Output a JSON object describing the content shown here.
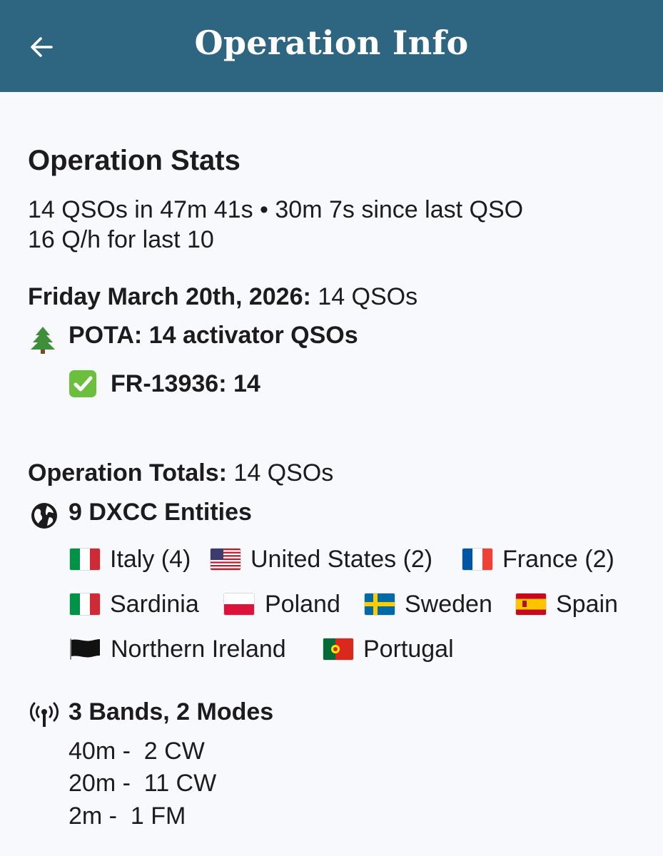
{
  "appbar": {
    "title": "Operation Info",
    "back_icon": "arrow-left-icon"
  },
  "stats": {
    "heading": "Operation Stats",
    "line1": "14 QSOs in 47m 41s • 30m 7s since last QSO",
    "line2": "16 Q/h for last 10"
  },
  "day": {
    "date_label": "Friday March 20th, 2026:",
    "date_count": "14 QSOs",
    "pota_icon": "evergreen-tree-icon",
    "pota_label": "POTA: 14 activator QSOs",
    "park_icon": "check-mark-button-icon",
    "park_label": "FR-13936: 14"
  },
  "totals": {
    "label": "Operation Totals:",
    "count": "14 QSOs",
    "dxcc_icon": "globe-icon",
    "dxcc_label": "9 DXCC Entities",
    "entities": [
      {
        "name": "Italy (4)",
        "flag": "italy-flag-icon"
      },
      {
        "name": "United States (2)",
        "flag": "united-states-flag-icon"
      },
      {
        "name": "France (2)",
        "flag": "france-flag-icon"
      },
      {
        "name": "Sardinia",
        "flag": "italy-flag-icon"
      },
      {
        "name": "Poland",
        "flag": "poland-flag-icon"
      },
      {
        "name": "Sweden",
        "flag": "sweden-flag-icon"
      },
      {
        "name": "Spain",
        "flag": "spain-flag-icon"
      },
      {
        "name": "Northern Ireland",
        "flag": "black-flag-icon"
      },
      {
        "name": "Portugal",
        "flag": "portugal-flag-icon"
      }
    ],
    "bands_icon": "antenna-icon",
    "bands_label": "3 Bands, 2 Modes",
    "bands": [
      "40m -  2 CW",
      "20m -  11 CW",
      "2m -  1 FM"
    ]
  }
}
